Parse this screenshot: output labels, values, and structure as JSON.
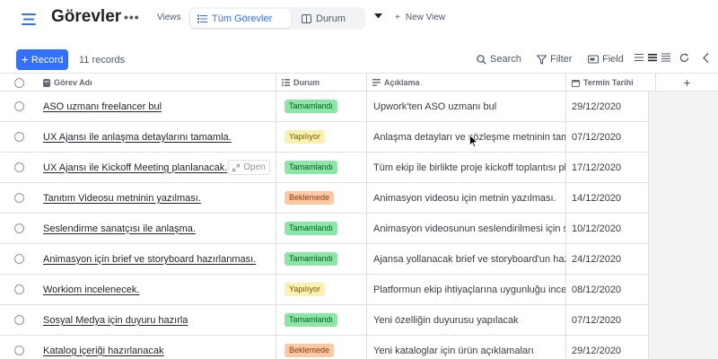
{
  "header": {
    "title": "Görevler",
    "views_label": "Views",
    "view_tabs": [
      {
        "label": "Tüm Görevler",
        "icon": "list-icon",
        "active": true
      },
      {
        "label": "Durum",
        "icon": "board-icon",
        "active": false
      }
    ],
    "new_view_label": "New View"
  },
  "toolbar": {
    "record_label": "Record",
    "records_count": "11 records",
    "search_label": "Search",
    "filter_label": "Filter",
    "field_label": "Field"
  },
  "table": {
    "columns": [
      {
        "label": "Görev Adı",
        "icon": "text-field-icon"
      },
      {
        "label": "Durum",
        "icon": "select-field-icon"
      },
      {
        "label": "Açıklama",
        "icon": "long-text-field-icon"
      },
      {
        "label": "Termin Tarihi",
        "icon": "date-field-icon"
      }
    ],
    "open_label": "Open",
    "rows": [
      {
        "name": "ASO uzmanı freelancer bul",
        "status": "Tamamlandı",
        "desc": "Upwork'ten ASO uzmanı bul",
        "date": "29/12/2020"
      },
      {
        "name": "UX Ajansı ile anlaşma detaylarını tamamla.",
        "status": "Yapılıyor",
        "desc": "Anlaşma detayları ve sözleşme metninin tam...",
        "date": "07/12/2020"
      },
      {
        "name": "UX Ajansı ile Kickoff Meeting planlanacak.",
        "status": "Tamamlandı",
        "desc": "Tüm ekip ile birlikte proje kickoff toplantısı pl...",
        "date": "17/12/2020"
      },
      {
        "name": "Tanıtım Videosu metninin yazılması.",
        "status": "Beklemede",
        "desc": "Animasyon videosu için metnin yazılması.",
        "date": "14/12/2020"
      },
      {
        "name": "Seslendirme sanatçısı ile anlaşma.",
        "status": "Tamamlandı",
        "desc": "Animasyon videosunun seslendirilmesi için s...",
        "date": "10/12/2020"
      },
      {
        "name": "Animasyon için brief ve storyboard hazırlanması.",
        "status": "Tamamlandı",
        "desc": "Ajansa yollanacak brief ve storyboard'un haz...",
        "date": "24/12/2020"
      },
      {
        "name": "Workiom incelenecek.",
        "status": "Yapılıyor",
        "desc": "Platformun ekip ihtiyaçlarına uygunluğu ince...",
        "date": "08/12/2020"
      },
      {
        "name": "Sosyal Medya için duyuru hazırla",
        "status": "Tamamlandı",
        "desc": "Yeni özelliğin duyurusu yapılacak",
        "date": "07/12/2020"
      },
      {
        "name": "Katalog içeriği hazırlanacak",
        "status": "Beklemede",
        "desc": "Yeni kataloglar için ürün açıklamaları",
        "date": "29/12/2020"
      }
    ]
  },
  "status_colors": {
    "Tamamlandı": {
      "bg": "#8be6a8",
      "fg": "#0a5c25"
    },
    "Yapılıyor": {
      "bg": "#faf0b0",
      "fg": "#7a5a00"
    },
    "Beklemede": {
      "bg": "#fdc9a4",
      "fg": "#8a3a07"
    }
  },
  "colors": {
    "accent": "#3370ff"
  }
}
